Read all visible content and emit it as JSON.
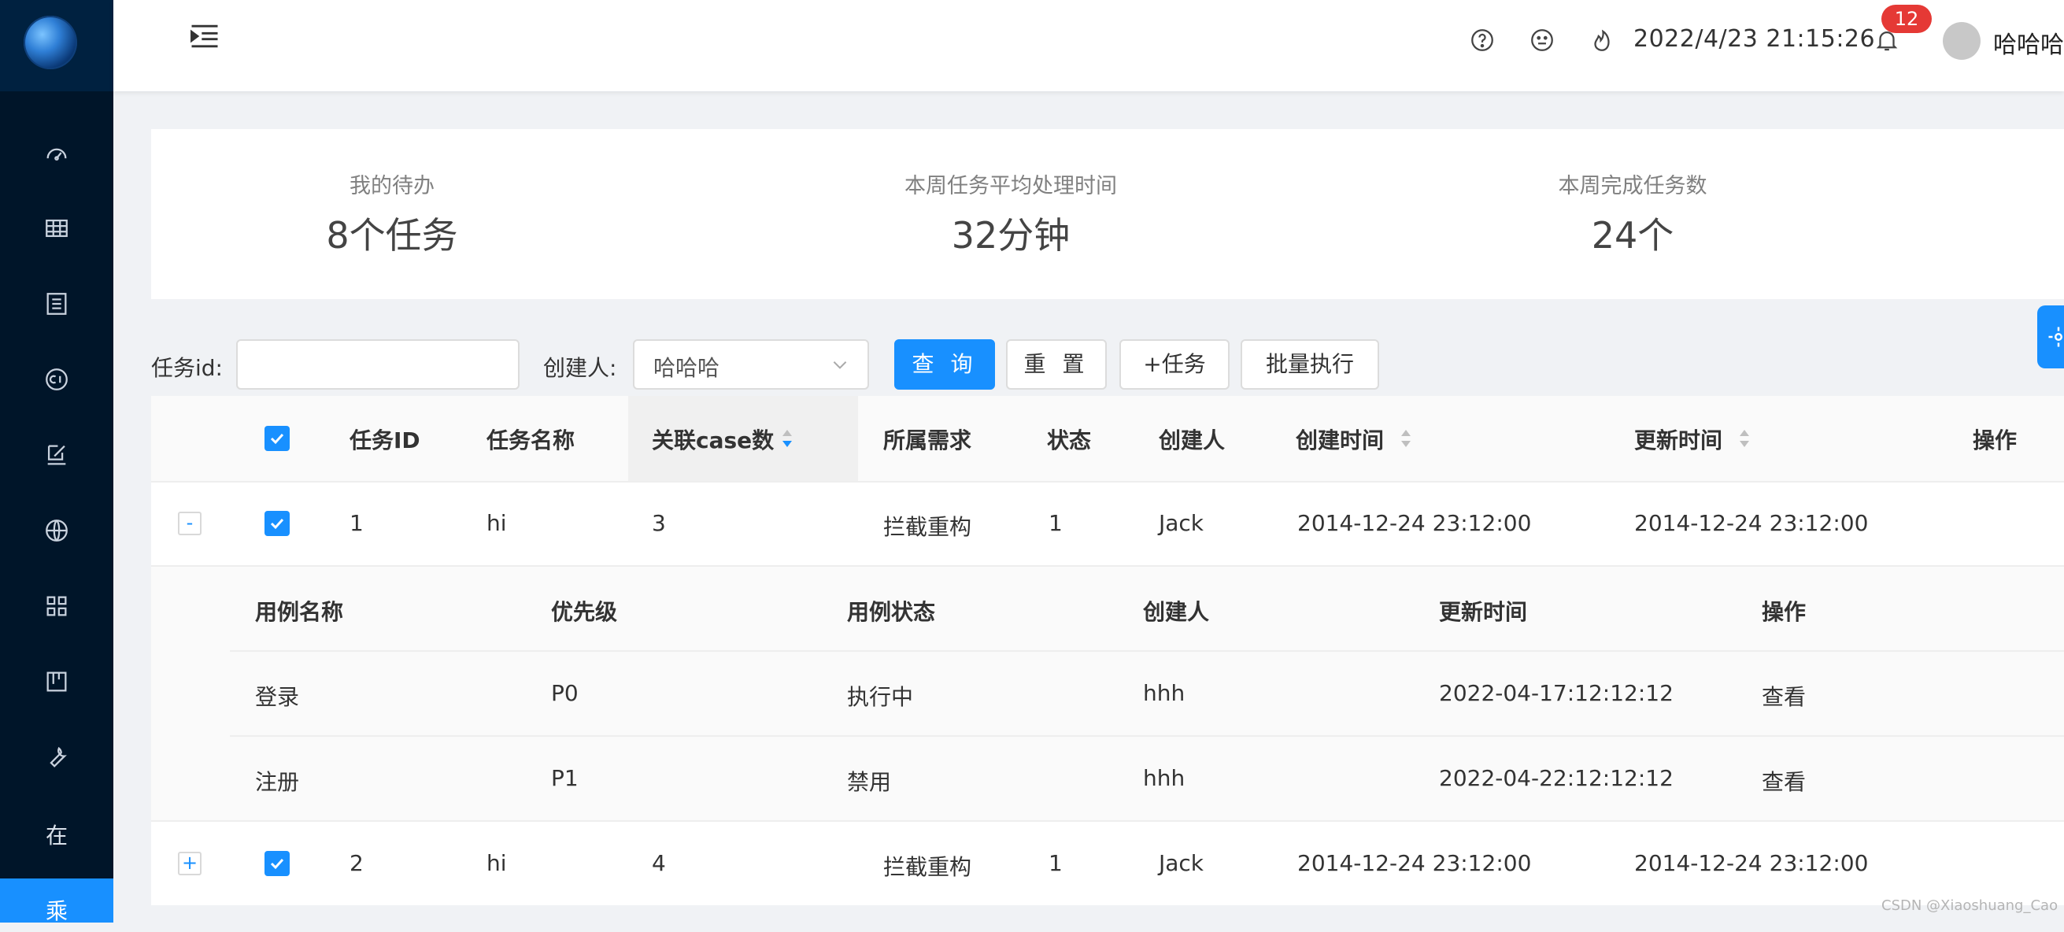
{
  "sidebar": {
    "items": [
      {
        "icon": "dashboard-icon"
      },
      {
        "icon": "table-icon"
      },
      {
        "icon": "list-icon"
      },
      {
        "icon": "ci-icon"
      },
      {
        "icon": "edit-icon"
      },
      {
        "icon": "globe-icon"
      },
      {
        "icon": "apps-icon"
      },
      {
        "icon": "board-icon"
      },
      {
        "icon": "wrench-icon"
      },
      {
        "label": "在"
      },
      {
        "label": "乘",
        "active": true
      }
    ]
  },
  "header": {
    "datetime": "2022/4/23 21:15:26",
    "notification_count": "12",
    "username": "哈哈哈"
  },
  "stats": [
    {
      "label": "我的待办",
      "value": "8个任务"
    },
    {
      "label": "本周任务平均处理时间",
      "value": "32分钟"
    },
    {
      "label": "本周完成任务数",
      "value": "24个"
    }
  ],
  "filters": {
    "task_id_label": "任务id:",
    "task_id_value": "",
    "creator_label": "创建人:",
    "creator_value": "哈哈哈",
    "query_button": "查 询",
    "reset_button": "重 置",
    "add_task_button": "+任务",
    "batch_button": "批量执行"
  },
  "table": {
    "columns": [
      "任务ID",
      "任务名称",
      "关联case数",
      "所属需求",
      "状态",
      "创建人",
      "创建时间",
      "更新时间",
      "操作"
    ],
    "rows": [
      {
        "expander": "-",
        "id": "1",
        "name": "hi",
        "case_count": "3",
        "requirement": "拦截重构",
        "status": "1",
        "creator": "Jack",
        "created": "2014-12-24 23:12:00",
        "updated": "2014-12-24 23:12:00"
      },
      {
        "expander": "+",
        "id": "2",
        "name": "hi",
        "case_count": "4",
        "requirement": "拦截重构",
        "status": "1",
        "creator": "Jack",
        "created": "2014-12-24 23:12:00",
        "updated": "2014-12-24 23:12:00"
      }
    ],
    "sub_table": {
      "columns": [
        "用例名称",
        "优先级",
        "用例状态",
        "创建人",
        "更新时间",
        "操作"
      ],
      "rows": [
        {
          "name": "登录",
          "priority": "P0",
          "status": "执行中",
          "creator": "hhh",
          "updated": "2022-04-17:12:12:12",
          "action": "查看"
        },
        {
          "name": "注册",
          "priority": "P1",
          "status": "禁用",
          "creator": "hhh",
          "updated": "2022-04-22:12:12:12",
          "action": "查看"
        }
      ]
    }
  },
  "watermark": "CSDN @Xiaoshuang_Cao",
  "colors": {
    "sidebar": "#001529",
    "primary": "#1890ff",
    "badge": "#e53935"
  }
}
